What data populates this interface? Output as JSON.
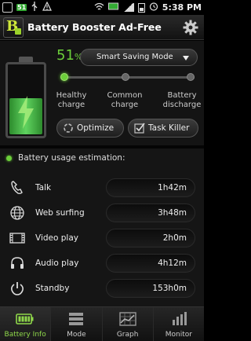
{
  "status_bar": {
    "badge": "51",
    "time": "5:38 PM"
  },
  "app": {
    "title": "Battery Booster Ad-Free",
    "logo_letter": "B"
  },
  "battery": {
    "percent": "51",
    "percent_unit": "%",
    "level_fraction": 0.51,
    "color": "#6ccf3a"
  },
  "mode": {
    "selected": "Smart Saving Mode"
  },
  "charge_slider": {
    "labels": [
      "Healthy\ncharge",
      "Common\ncharge",
      "Battery\ndischarge"
    ],
    "label_lines": [
      [
        "Healthy",
        "charge"
      ],
      [
        "Common",
        "charge"
      ],
      [
        "Battery",
        "discharge"
      ]
    ],
    "active_index": 0
  },
  "actions": {
    "optimize_label": "Optimize",
    "task_killer_label": "Task Killer"
  },
  "usage": {
    "header": "Battery usage estimation:",
    "rows": [
      {
        "label": "Talk",
        "value": "1h42m",
        "icon": "phone-icon"
      },
      {
        "label": "Web surfing",
        "value": "3h48m",
        "icon": "globe-icon"
      },
      {
        "label": "Video play",
        "value": "2h0m",
        "icon": "film-icon"
      },
      {
        "label": "Audio play",
        "value": "4h12m",
        "icon": "headphones-icon"
      },
      {
        "label": "Standby",
        "value": "153h0m",
        "icon": "power-icon"
      }
    ]
  },
  "nav": {
    "tabs": [
      {
        "label": "Battery Info",
        "icon": "battery-icon",
        "active": true
      },
      {
        "label": "Mode",
        "icon": "list-icon",
        "active": false
      },
      {
        "label": "Graph",
        "icon": "graph-icon",
        "active": false
      },
      {
        "label": "Monitor",
        "icon": "monitor-icon",
        "active": false
      }
    ]
  }
}
